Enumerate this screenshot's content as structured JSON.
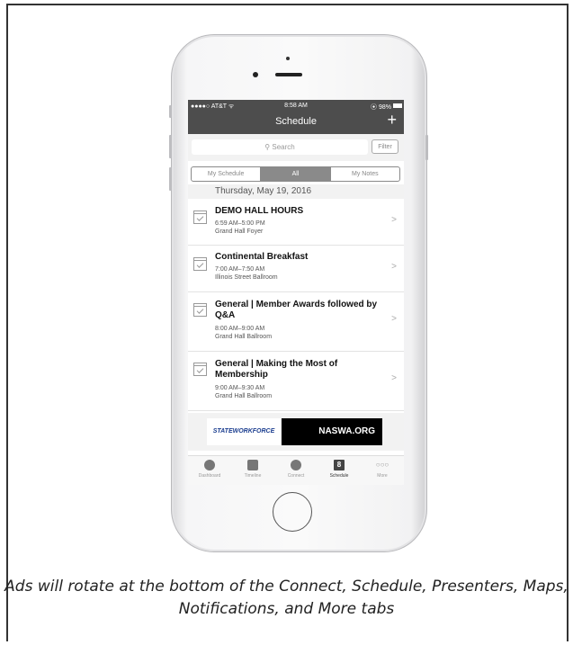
{
  "caption": "Ads will rotate at the bottom of the Connect, Schedule, Presenters, Maps, Notifications, and More tabs",
  "status": {
    "carrier": "●●●●○ AT&T ᯤ",
    "time": "8:58 AM",
    "battery": "⦿ 98%"
  },
  "nav": {
    "title": "Schedule",
    "add": "+"
  },
  "search": {
    "placeholder": "⚲ Search",
    "filter": "Filter"
  },
  "segments": {
    "my_schedule": "My Schedule",
    "all": "All",
    "my_notes": "My Notes"
  },
  "day_header": "Thursday, May 19, 2016",
  "sessions": [
    {
      "title": "DEMO HALL HOURS",
      "time": "6:59 AM–5:00 PM",
      "location": "Grand Hall Foyer"
    },
    {
      "title": "Continental Breakfast",
      "time": "7:00 AM–7:50 AM",
      "location": "Illinois Street Ballroom"
    },
    {
      "title": "General | Member Awards followed by Q&A",
      "time": "8:00 AM–9:00 AM",
      "location": "Grand Hall Ballroom"
    },
    {
      "title": "General | Making the Most of Membership",
      "time": "9:00 AM–9:30 AM",
      "location": "Grand Hall Ballroom"
    }
  ],
  "ad": {
    "left_logo": "STATEWORKFORCE",
    "right_text": "NASWA.ORG"
  },
  "tabs": {
    "dashboard": "Dashboard",
    "timeline": "Timeline",
    "connect": "Connect",
    "schedule": "Schedule",
    "schedule_day": "8",
    "more": "More",
    "more_glyph": "○○○"
  },
  "chevron": ">"
}
